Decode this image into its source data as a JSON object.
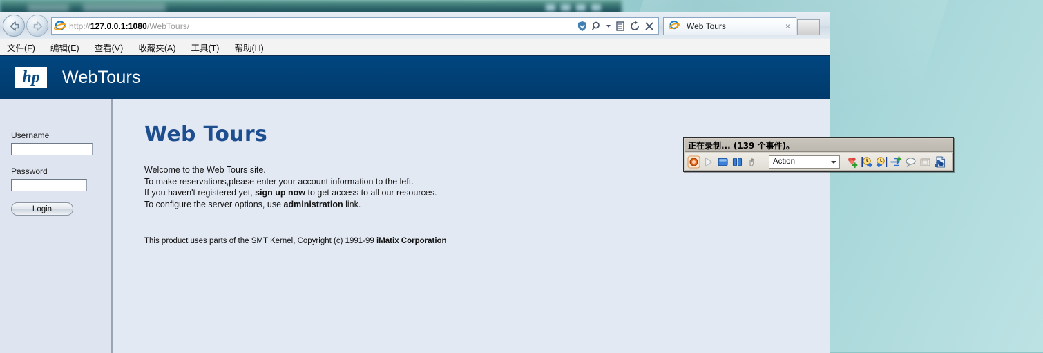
{
  "browser": {
    "nav": {
      "back_label": "Back",
      "forward_label": "Forward",
      "back_icon": "arrow-left-icon",
      "forward_icon": "arrow-right-icon"
    },
    "address": {
      "url_protocol": "http://",
      "url_host": "127.0.0.1:1080",
      "url_path": "/WebTours/",
      "full_url": "http://127.0.0.1:1080/WebTours/",
      "page_icon": "internet-explorer-icon",
      "icons": [
        {
          "name": "compatibility-view-icon",
          "glyph": "shield"
        },
        {
          "name": "search-icon",
          "glyph": "magnifier"
        },
        {
          "name": "dropdown-arrow-icon",
          "glyph": "caret-down"
        },
        {
          "name": "page-options-icon",
          "glyph": "page"
        },
        {
          "name": "refresh-icon",
          "glyph": "refresh"
        },
        {
          "name": "stop-icon",
          "glyph": "x"
        }
      ]
    },
    "tabs": [
      {
        "label": "Web Tours",
        "close_label": "×",
        "icon": "internet-explorer-icon",
        "active": true
      }
    ],
    "new_tab_label": "",
    "menu": [
      {
        "label": "文件(F)"
      },
      {
        "label": "编辑(E)"
      },
      {
        "label": "查看(V)"
      },
      {
        "label": "收藏夹(A)"
      },
      {
        "label": "工具(T)"
      },
      {
        "label": "帮助(H)"
      }
    ]
  },
  "site": {
    "brand": {
      "logo_text": "hp",
      "title": "WebTours",
      "header_color": "#013a6b"
    },
    "login": {
      "username_label": "Username",
      "username_value": "",
      "password_label": "Password",
      "password_value": "",
      "login_button": "Login"
    },
    "main": {
      "heading": "Web Tours",
      "heading_color": "#1d4e8f",
      "lines": [
        {
          "pre": "Welcome to the Web Tours site.",
          "bold": "",
          "post": ""
        },
        {
          "pre": "To make reservations,please enter your account information to the left.",
          "bold": "",
          "post": ""
        },
        {
          "pre": "If you haven't registered yet, ",
          "bold": "sign up now",
          "post": " to get access to all our resources."
        },
        {
          "pre": "To configure the server options, use ",
          "bold": "administration",
          "post": " link."
        }
      ],
      "footer_pre": "This product uses parts of the SMT Kernel, Copyright (c) 1991-99 ",
      "footer_bold": "iMatix Corporation"
    }
  },
  "recorder": {
    "title": "正在录制... (139 个事件)。",
    "event_count": "139",
    "action_value": "Action",
    "buttons": [
      {
        "name": "record-button",
        "label": "Record",
        "enabled": true
      },
      {
        "name": "play-button",
        "label": "Play",
        "enabled": false
      },
      {
        "name": "stop-button",
        "label": "Stop",
        "enabled": true
      },
      {
        "name": "pause-button",
        "label": "Pause",
        "enabled": true
      },
      {
        "name": "hand-cursor-button",
        "label": "Select",
        "enabled": false
      }
    ],
    "tools": [
      {
        "name": "insert-step-button",
        "label": "Insert Step"
      },
      {
        "name": "start-transaction-button",
        "label": "Start Transaction"
      },
      {
        "name": "end-transaction-button",
        "label": "End Transaction"
      },
      {
        "name": "insert-rendezvous-button",
        "label": "Insert Rendezvous"
      },
      {
        "name": "insert-comment-button",
        "label": "Insert Comment"
      },
      {
        "name": "insert-text-check-button",
        "label": "Insert Text Check"
      },
      {
        "name": "snapshot-button",
        "label": "Snapshot"
      }
    ]
  }
}
